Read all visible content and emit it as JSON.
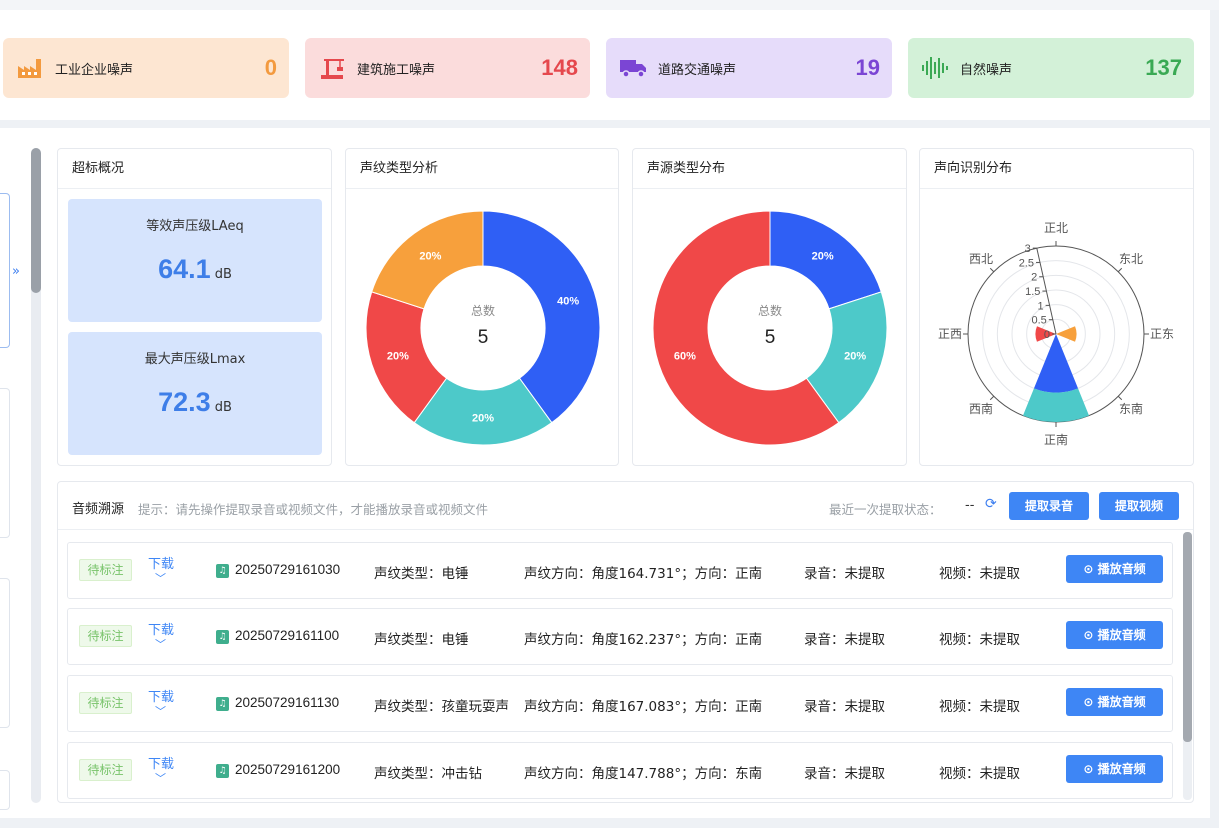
{
  "stats": [
    {
      "label": "工业企业噪声",
      "value": "0",
      "icon": "factory-icon",
      "color": "#f39a3f"
    },
    {
      "label": "建筑施工噪声",
      "value": "148",
      "icon": "construction-crane-icon",
      "color": "#e5484d"
    },
    {
      "label": "道路交通噪声",
      "value": "19",
      "icon": "truck-icon",
      "color": "#7b45d4"
    },
    {
      "label": "自然噪声",
      "value": "137",
      "icon": "soundwave-icon",
      "color": "#3aa954"
    }
  ],
  "exceed": {
    "title": "超标概况",
    "laeq": {
      "label": "等效声压级LAeq",
      "value": "64.1",
      "unit": "dB"
    },
    "lmax": {
      "label": "最大声压级Lmax",
      "value": "72.3",
      "unit": "dB"
    }
  },
  "voiceprint": {
    "title": "声纹类型分析",
    "center_label": "总数",
    "center_value": "5"
  },
  "source": {
    "title": "声源类型分布",
    "center_label": "总数",
    "center_value": "5"
  },
  "direction": {
    "title": "声向识别分布"
  },
  "chart_data": [
    {
      "type": "pie",
      "title": "声纹类型分析",
      "slices": [
        {
          "value": 40,
          "label": "40%",
          "color": "#2f5ff5"
        },
        {
          "value": 20,
          "label": "20%",
          "color": "#4dc9c9"
        },
        {
          "value": 20,
          "label": "20%",
          "color": "#f04848"
        },
        {
          "value": 20,
          "label": "20%",
          "color": "#f7a03c"
        }
      ]
    },
    {
      "type": "pie",
      "title": "声源类型分布",
      "slices": [
        {
          "value": 20,
          "label": "20%",
          "color": "#2f5ff5"
        },
        {
          "value": 20,
          "label": "20%",
          "color": "#4dc9c9"
        },
        {
          "value": 60,
          "label": "60%",
          "color": "#f04848"
        }
      ]
    },
    {
      "type": "polar-bar",
      "title": "声向识别分布",
      "directions": [
        "正北",
        "东北",
        "正东",
        "东南",
        "正南",
        "西南",
        "正西",
        "西北"
      ],
      "radial_ticks": [
        "0",
        "0.5",
        "1",
        "1.5",
        "2",
        "2.5",
        "3"
      ],
      "rmax": 3,
      "bars": [
        {
          "direction": "正东",
          "segments": [
            {
              "value": 0.7,
              "color": "#f7a03c"
            }
          ]
        },
        {
          "direction": "正南",
          "segments": [
            {
              "value": 2,
              "color": "#2f5ff5"
            },
            {
              "value": 3,
              "color": "#4dc9c9"
            }
          ]
        },
        {
          "direction": "正西",
          "segments": [
            {
              "value": 0.7,
              "color": "#f04848"
            }
          ]
        }
      ]
    }
  ],
  "trace": {
    "title": "音频溯源",
    "hint": "提示：请先操作提取录音或视频文件，才能播放录音或视频文件",
    "status_label": "最近一次提取状态：",
    "status_value": "--",
    "btn_record": "提取录音",
    "btn_video": "提取视频",
    "rows": [
      {
        "tag": "待标注",
        "download": "下载",
        "file": "20250729161030",
        "type": "声纹类型：电锤",
        "dir": "声纹方向：角度164.731°；方向：正南",
        "rec": "录音：未提取",
        "video": "视频：未提取",
        "play": "播放音频"
      },
      {
        "tag": "待标注",
        "download": "下载",
        "file": "20250729161100",
        "type": "声纹类型：电锤",
        "dir": "声纹方向：角度162.237°；方向：正南",
        "rec": "录音：未提取",
        "video": "视频：未提取",
        "play": "播放音频"
      },
      {
        "tag": "待标注",
        "download": "下载",
        "file": "20250729161130",
        "type": "声纹类型：孩童玩耍声",
        "dir": "声纹方向：角度167.083°；方向：正南",
        "rec": "录音：未提取",
        "video": "视频：未提取",
        "play": "播放音频"
      },
      {
        "tag": "待标注",
        "download": "下载",
        "file": "20250729161200",
        "type": "声纹类型：冲击钻",
        "dir": "声纹方向：角度147.788°；方向：东南",
        "rec": "录音：未提取",
        "video": "视频：未提取",
        "play": "播放音频"
      }
    ]
  }
}
